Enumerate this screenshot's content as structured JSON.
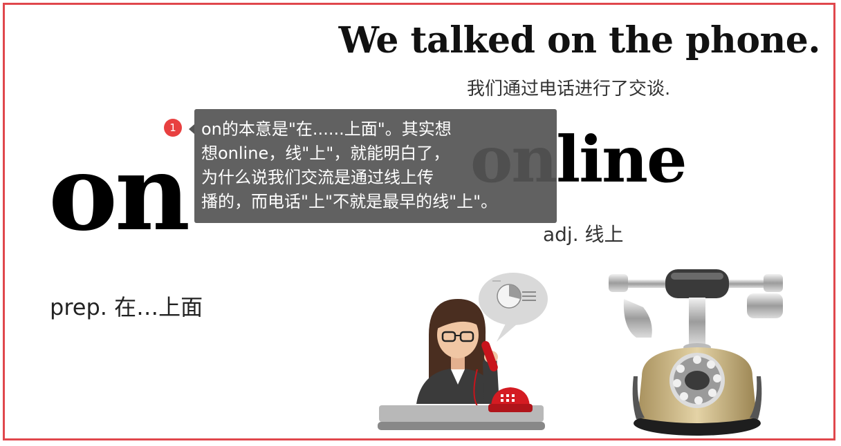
{
  "slide": {
    "sentence": "We talked on the phone.",
    "translation": "我们通过电话进行了交谈.",
    "word_on": "on",
    "word_online": "online",
    "def_on": "prep. 在…上面",
    "def_online": "adj. 线上"
  },
  "annotation": {
    "badge": "1",
    "lines": [
      "on的本意是\"在......上面\"。其实想",
      "想online，线\"上\"，就能明白了，",
      "为什么说我们交流是通过线上传",
      "播的，而电话\"上\"不就是最早的线\"上\"。"
    ]
  },
  "colors": {
    "border": "#e0474c",
    "badge": "#e84040",
    "note_bg": "#555555"
  },
  "illustrations": {
    "woman_icon": "woman-on-phone-icon",
    "phone_icon": "vintage-telephone-icon"
  }
}
